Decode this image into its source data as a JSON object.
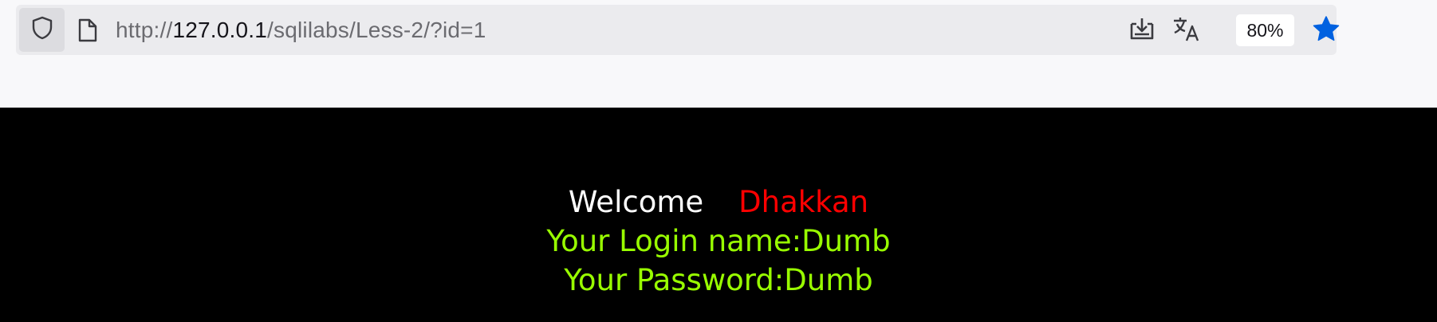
{
  "browser": {
    "url_prefix": "http://",
    "url_host": "127.0.0.1",
    "url_path": "/sqlilabs/Less-2/?id=1",
    "zoom": "80%",
    "icons": {
      "shield": "shield-icon",
      "page": "page-icon",
      "download": "download-icon",
      "translate": "translate-icon",
      "bookmark": "star-icon"
    },
    "accent_color": "#0061e0"
  },
  "page": {
    "welcome": "Welcome",
    "user_name": "Dhakkan",
    "login_line": "Your Login name:Dumb",
    "password_line": "Your Password:Dumb",
    "colors": {
      "background": "#000000",
      "welcome": "#ffffff",
      "user_name": "#ff0000",
      "info": "#99ff00"
    }
  }
}
